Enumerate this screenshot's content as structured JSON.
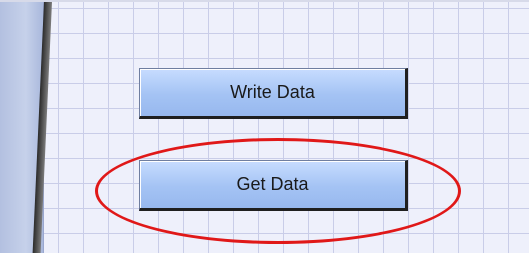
{
  "buttons": {
    "write_data_label": "Write Data",
    "get_data_label": "Get Data"
  },
  "colors": {
    "canvas_background": "#eef0fb",
    "grid_line": "#c9cde8",
    "button_fill": "#a4c3f4",
    "highlight_ellipse": "#e01818"
  }
}
